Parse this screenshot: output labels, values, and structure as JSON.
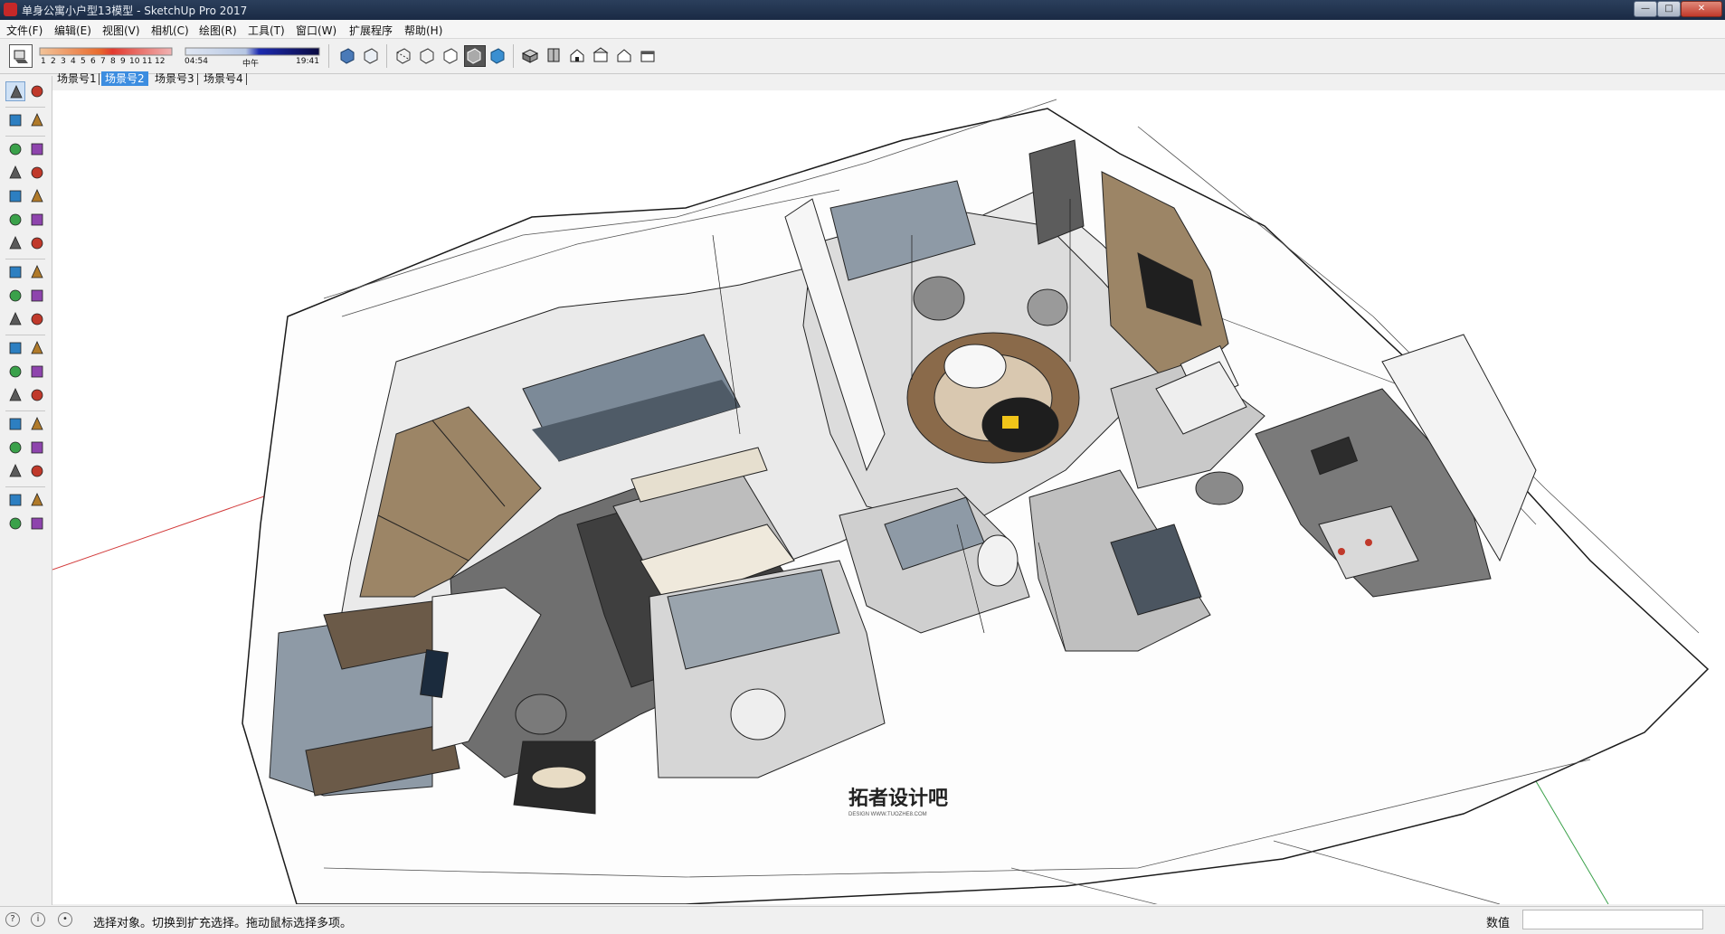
{
  "window": {
    "title": "单身公寓小户型13模型 - SketchUp Pro 2017",
    "minimize_icon": "minimize-icon",
    "maximize_icon": "maximize-icon",
    "close_icon": "close-icon",
    "minimize_glyph": "—",
    "maximize_glyph": "□",
    "close_glyph": "✕"
  },
  "menu": {
    "items": [
      {
        "label": "文件(F)"
      },
      {
        "label": "编辑(E)"
      },
      {
        "label": "视图(V)"
      },
      {
        "label": "相机(C)"
      },
      {
        "label": "绘图(R)"
      },
      {
        "label": "工具(T)"
      },
      {
        "label": "窗口(W)"
      },
      {
        "label": "扩展程序"
      },
      {
        "label": "帮助(H)"
      }
    ]
  },
  "toolbar": {
    "shadow_months": [
      "1",
      "2",
      "3",
      "4",
      "5",
      "6",
      "7",
      "8",
      "9",
      "10",
      "11",
      "12"
    ],
    "time_labels": {
      "start": "04:54",
      "mid": "中午",
      "end": "19:41"
    },
    "icons": [
      "shadows-toggle-icon",
      "fog-icon",
      "xray-style-icon",
      "backedges-style-icon",
      "wireframe-style-icon",
      "hiddenline-style-icon",
      "shaded-style-icon",
      "shaded-textures-style-icon",
      "monochrome-style-icon",
      "iso-view-icon",
      "top-view-icon",
      "front-view-icon",
      "right-view-icon",
      "back-view-icon",
      "left-view-icon"
    ]
  },
  "scenes": {
    "tabs": [
      {
        "label": "场景号1",
        "active": false
      },
      {
        "label": "场景号2",
        "active": true
      },
      {
        "label": "场景号3",
        "active": false
      },
      {
        "label": "场景号4",
        "active": false
      }
    ]
  },
  "left_tools": [
    "select-tool-icon",
    "make-component-icon",
    "paint-bucket-icon",
    "eraser-icon",
    "line-tool-icon",
    "freehand-tool-icon",
    "rectangle-tool-icon",
    "rotated-rectangle-icon",
    "circle-tool-icon",
    "polygon-tool-icon",
    "arc-tool-icon",
    "two-point-arc-icon",
    "three-point-arc-icon",
    "pie-tool-icon",
    "move-tool-icon",
    "push-pull-icon",
    "rotate-tool-icon",
    "follow-me-icon",
    "scale-tool-icon",
    "offset-tool-icon",
    "tape-measure-icon",
    "dimension-tool-icon",
    "protractor-icon",
    "text-tool-icon",
    "axes-tool-icon",
    "3d-text-icon",
    "orbit-tool-icon",
    "pan-tool-icon",
    "zoom-tool-icon",
    "zoom-window-icon",
    "zoom-extents-icon",
    "previous-view-icon",
    "position-camera-icon",
    "look-around-icon",
    "walk-tool-icon",
    "section-plane-icon"
  ],
  "viewport": {
    "watermark_main": "拓者设计吧",
    "watermark_sub": "DESIGN WWW.TUOZHE8.COM",
    "colors": {
      "wall": "#ffffff",
      "edge": "#1a1a1a",
      "wood": "#9c8566",
      "floor_dark": "#6f6f6f",
      "rug": "#8a6a4a",
      "glass": "#8e9aa6",
      "red_axis": "#d23a3a",
      "green_axis": "#3aa14a"
    }
  },
  "status": {
    "text": "选择对象。切换到扩充选择。拖动鼠标选择多项。",
    "measure_label": "数值",
    "measure_value": "",
    "icons": [
      "geo-location-icon",
      "info-icon",
      "user-icon"
    ]
  }
}
